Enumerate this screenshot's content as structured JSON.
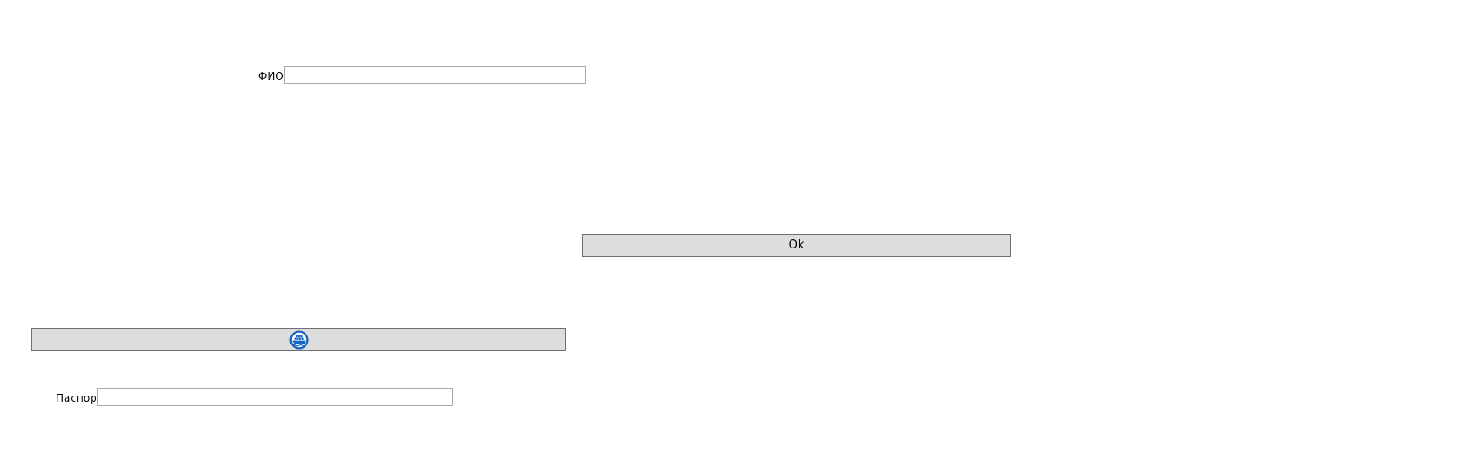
{
  "form": {
    "fio_label": "ФИО",
    "fio_value": "",
    "passport_label": "Паспорт",
    "passport_value": "",
    "ok_label": "Ok",
    "icon_button_icon": "ship-container-icon",
    "icon_color": "#1565c0"
  }
}
